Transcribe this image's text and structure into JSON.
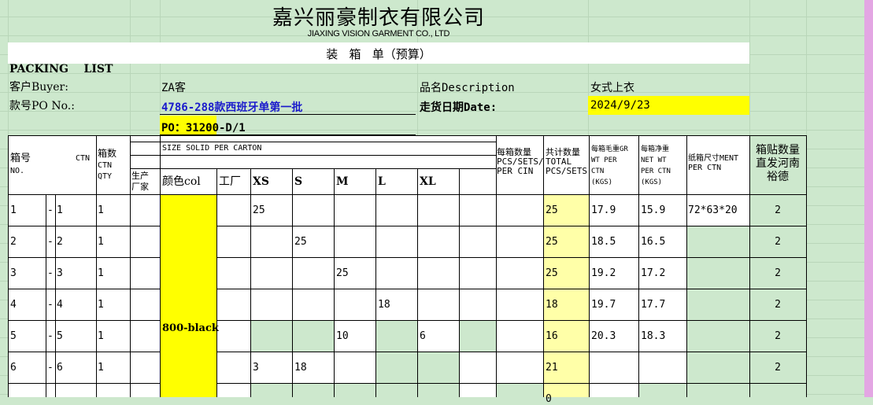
{
  "company": {
    "name_cn": "嘉兴丽豪制衣有限公司",
    "name_en": "JIAXING VISION GARMENT CO., LTD"
  },
  "doc": {
    "subtitle": "装   箱   单（预算）",
    "packing_list": "PACKING    LIST"
  },
  "info": {
    "buyer_label": "客户Buyer:",
    "buyer_value": "ZA客",
    "desc_label": "品名Description",
    "desc_value": "女式上衣",
    "po_label": "款号PO No.:",
    "po_value": "4786-288款西班牙单第一批",
    "date_label": "走货日期Date:",
    "date_value": "2024/9/23",
    "po_number": "PO：31200-D/1"
  },
  "header": {
    "box_no": "箱号",
    "no": "NO.",
    "ctn": "CTN",
    "box_qty": "箱数",
    "box_qty_ctn": "CTN",
    "box_qty_qty": "QTY",
    "size_solid": "SIZE SOLID PER CARTON",
    "factory": "生产厂家",
    "color": "颜色col",
    "workshop": "工厂",
    "sizes": [
      "XS",
      "S",
      "M",
      "L",
      "XL"
    ],
    "pcs_per_ctn_1": "每箱数量",
    "pcs_per_ctn_2": "PCS/SETS/",
    "pcs_per_ctn_3": "PER CIN",
    "total_1": "共计数量",
    "total_2": "TOTAL",
    "total_3": "PCS/SETS",
    "gross_1": "每箱毛重GR",
    "gross_2": "WT PER",
    "gross_3": "CTN",
    "gross_4": "(KGS)",
    "net_1": "每箱净重",
    "net_2": "NET WT",
    "net_3": "PER CTN",
    "net_4": "(KGS)",
    "carton_1": "纸箱尺寸MENT",
    "carton_2": "PER CTN",
    "label_1": "箱贴数量",
    "label_2": "直发河南",
    "label_3": "裕德"
  },
  "color_value": "800-black",
  "rows": [
    {
      "from": "1",
      "dash": "-",
      "to": "1",
      "qty": "1",
      "xs": "25",
      "s": "",
      "m": "",
      "l": "",
      "xl": "",
      "total": "25",
      "gross": "17.9",
      "net": "15.9",
      "carton": "72*63*20",
      "labels": "2"
    },
    {
      "from": "2",
      "dash": "-",
      "to": "2",
      "qty": "1",
      "xs": "",
      "s": "25",
      "m": "",
      "l": "",
      "xl": "",
      "total": "25",
      "gross": "18.5",
      "net": "16.5",
      "carton": "",
      "labels": "2"
    },
    {
      "from": "3",
      "dash": "-",
      "to": "3",
      "qty": "1",
      "xs": "",
      "s": "",
      "m": "25",
      "l": "",
      "xl": "",
      "total": "25",
      "gross": "19.2",
      "net": "17.2",
      "carton": "",
      "labels": "2"
    },
    {
      "from": "4",
      "dash": "-",
      "to": "4",
      "qty": "1",
      "xs": "",
      "s": "",
      "m": "",
      "l": "18",
      "xl": "",
      "total": "18",
      "gross": "19.7",
      "net": "17.7",
      "carton": "",
      "labels": "2"
    },
    {
      "from": "5",
      "dash": "-",
      "to": "5",
      "qty": "1",
      "xs": "",
      "s": "",
      "m": "10",
      "l": "",
      "xl": "6",
      "total": "16",
      "gross": "20.3",
      "net": "18.3",
      "carton": "",
      "labels": "2"
    },
    {
      "from": "6",
      "dash": "-",
      "to": "6",
      "qty": "1",
      "xs": "3",
      "s": "18",
      "m": "",
      "l": "",
      "xl": "",
      "total": "21",
      "gross": "",
      "net": "",
      "carton": "",
      "labels": "2"
    },
    {
      "from": "",
      "dash": "",
      "to": "",
      "qty": "",
      "xs": "",
      "s": "",
      "m": "",
      "l": "",
      "xl": "",
      "total": "0",
      "gross": "",
      "net": "",
      "carton": "",
      "labels": ""
    }
  ]
}
